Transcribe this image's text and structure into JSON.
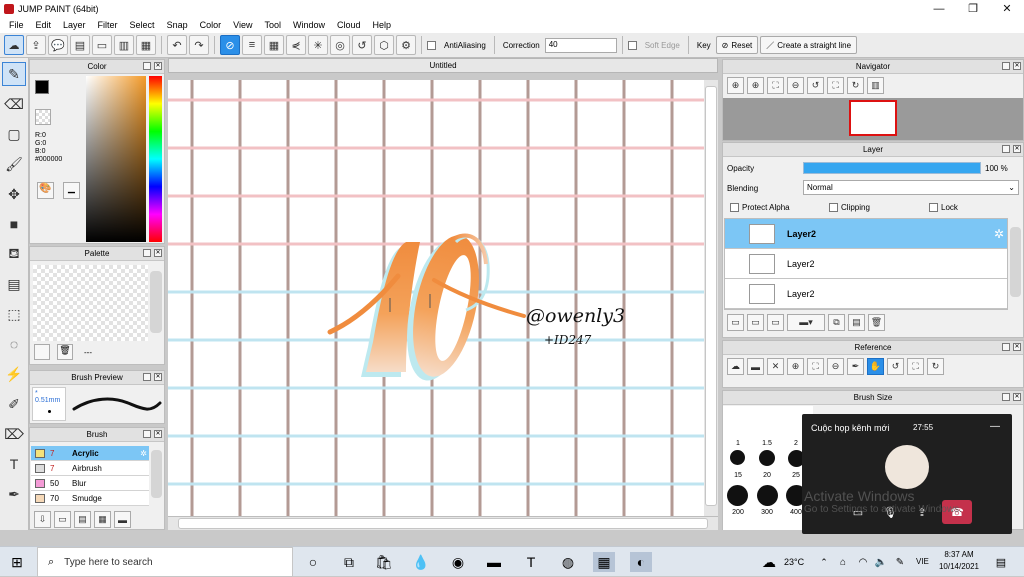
{
  "window": {
    "title": "JUMP PAINT (64bit)",
    "minimize": "—",
    "maximize": "❐",
    "close": "✕"
  },
  "menu": [
    "File",
    "Edit",
    "Layer",
    "Filter",
    "Select",
    "Snap",
    "Color",
    "View",
    "Tool",
    "Window",
    "Cloud",
    "Help"
  ],
  "toolbar": {
    "antialiasing_label": "AntiAliasing",
    "correction_label": "Correction",
    "correction_value": "40",
    "soft_edge_label": "Soft Edge",
    "key_label": "Key",
    "reset_label": "Reset",
    "straight_line_label": "Create a straight line"
  },
  "color_panel": {
    "title": "Color",
    "r": "R:0",
    "g": "G:0",
    "b": "B:0",
    "hex": "#000000",
    "fg": "#000000",
    "bg": "#f18fc6"
  },
  "palette_panel": {
    "title": "Palette",
    "dash": "---"
  },
  "brush_preview": {
    "title": "Brush Preview",
    "size": "0.51mm"
  },
  "brush_panel": {
    "title": "Brush",
    "items": [
      {
        "size": "7",
        "name": "Acrylic",
        "color": "#f4e27a",
        "sel": true,
        "red": true
      },
      {
        "size": "7",
        "name": "Airbrush",
        "color": "#dddddd",
        "sel": false,
        "red": true
      },
      {
        "size": "50",
        "name": "Blur",
        "color": "#f49bd6",
        "sel": false,
        "red": false
      },
      {
        "size": "70",
        "name": "Smudge",
        "color": "#f6d9b8",
        "sel": false,
        "red": false
      }
    ]
  },
  "document": {
    "title": "Untitled",
    "signature": "@owenly3",
    "tag": "+ID247"
  },
  "navigator": {
    "title": "Navigator"
  },
  "layer_panel": {
    "title": "Layer",
    "opacity_label": "Opacity",
    "opacity_value": "100 %",
    "opacity_fraction": 1.0,
    "blending_label": "Blending",
    "blending_value": "Normal",
    "protect_alpha": "Protect Alpha",
    "clipping": "Clipping",
    "lock": "Lock",
    "layers": [
      {
        "name": "Layer2",
        "sel": true
      },
      {
        "name": "Layer2",
        "sel": false
      },
      {
        "name": "Layer2",
        "sel": false
      }
    ]
  },
  "reference_panel": {
    "title": "Reference"
  },
  "brush_size_panel": {
    "title": "Brush Size",
    "row1": [
      "1",
      "1.5",
      "2"
    ],
    "row2": [
      "15",
      "20",
      "25"
    ],
    "row3": [
      "200",
      "300",
      "400"
    ]
  },
  "meeting_popup": {
    "title": "Cuộc họp kênh mới",
    "time": "27:55"
  },
  "activation": {
    "line1": "Activate Windows",
    "line2": "Go to Settings to activate Windows."
  },
  "taskbar": {
    "search_placeholder": "Type here to search",
    "temperature": "23°C",
    "lang": "VIE",
    "time": "8:37 AM",
    "date": "10/14/2021"
  }
}
